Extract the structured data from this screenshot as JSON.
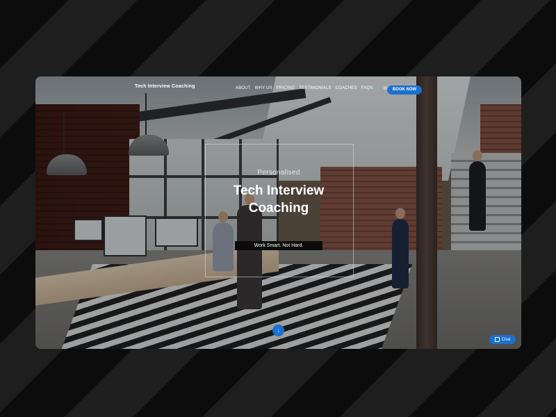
{
  "nav": {
    "logo": "Tech Interview Coaching",
    "menu": [
      {
        "label": "ABOUT"
      },
      {
        "label": "WHY US"
      },
      {
        "label": "PRICING"
      },
      {
        "label": "TESTIMONIALS"
      },
      {
        "label": "COACHES"
      },
      {
        "label": "FAQS"
      },
      {
        "label": "🔗 BLOG"
      }
    ],
    "cta": "BOOK NOW"
  },
  "hero": {
    "eyebrow": "Personalised",
    "headline": "Tech Interview Coaching",
    "tagline": "Work Smart. Not Hard.",
    "scroll_icon": "↓"
  },
  "chat": {
    "label": "Chat",
    "icon": "chat-icon"
  },
  "colors": {
    "accent": "#1d6fd0",
    "background": "#111111",
    "text": "#ffffff"
  }
}
